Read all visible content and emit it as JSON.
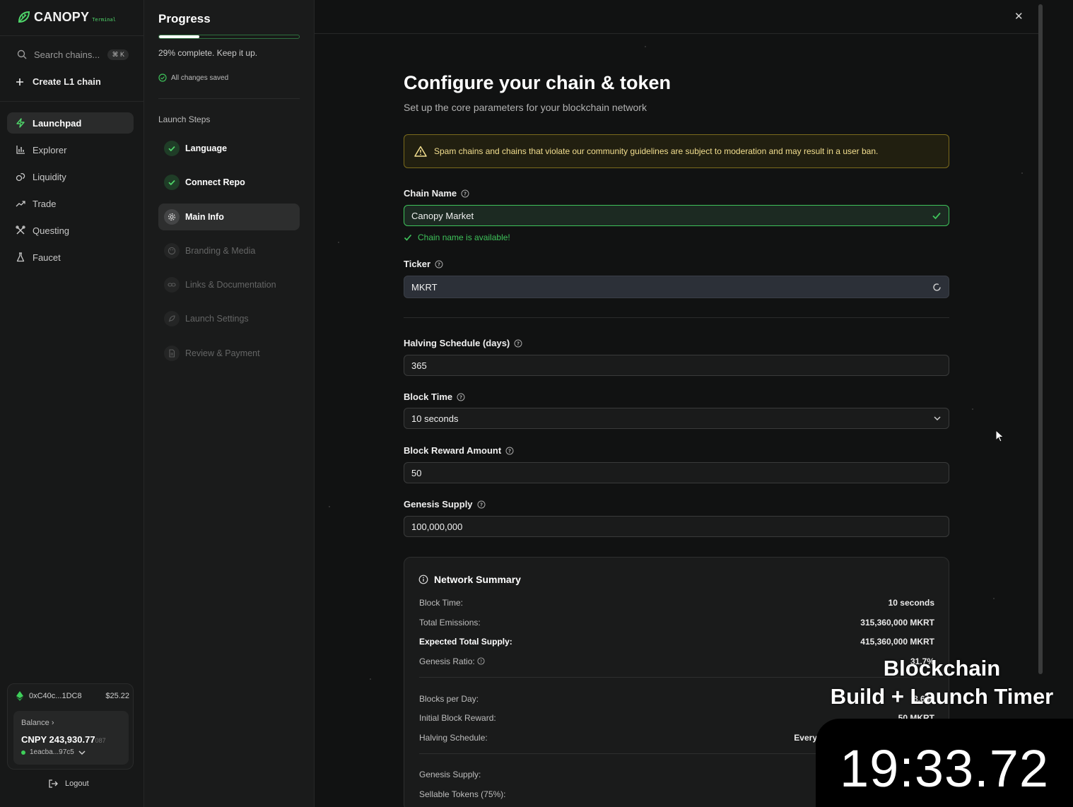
{
  "brand": {
    "name": "CANOPY",
    "sub": "Terminal"
  },
  "nav": {
    "search_placeholder": "Search chains...",
    "search_kbd": "⌘ K",
    "create_label": "Create L1 chain",
    "items": [
      {
        "label": "Launchpad",
        "icon": "bolt-icon"
      },
      {
        "label": "Explorer",
        "icon": "bar-chart-icon"
      },
      {
        "label": "Liquidity",
        "icon": "coins-icon"
      },
      {
        "label": "Trade",
        "icon": "trend-up-icon"
      },
      {
        "label": "Questing",
        "icon": "tools-icon"
      },
      {
        "label": "Faucet",
        "icon": "flask-icon"
      }
    ],
    "active_item": "Launchpad"
  },
  "wallet": {
    "address": "0xC40c...1DC8",
    "usd": "$25.22",
    "balance_label": "Balance",
    "balance_main": "CNPY 243,930.77",
    "balance_frac": "087",
    "account": "1eacba...97c5",
    "logout_label": "Logout"
  },
  "progress": {
    "title": "Progress",
    "percent": 29,
    "text": "29% complete. Keep it up.",
    "saved": "All changes saved",
    "steps_title": "Launch Steps",
    "steps": [
      {
        "label": "Language",
        "state": "done",
        "icon": "check-icon"
      },
      {
        "label": "Connect Repo",
        "state": "done",
        "icon": "check-icon"
      },
      {
        "label": "Main Info",
        "state": "active",
        "icon": "gear-icon"
      },
      {
        "label": "Branding & Media",
        "state": "todo",
        "icon": "palette-icon"
      },
      {
        "label": "Links & Documentation",
        "state": "todo",
        "icon": "link-icon"
      },
      {
        "label": "Launch Settings",
        "state": "todo",
        "icon": "rocket-icon"
      },
      {
        "label": "Review & Payment",
        "state": "todo",
        "icon": "document-icon"
      }
    ]
  },
  "form": {
    "title": "Configure your chain & token",
    "subtitle": "Set up the core parameters for your blockchain network",
    "warning": "Spam chains and chains that violate our community guidelines are subject to moderation and may result in a user ban.",
    "chain_name": {
      "label": "Chain Name",
      "value": "Canopy Market",
      "status": "Chain name is available!"
    },
    "ticker": {
      "label": "Ticker",
      "value": "MKRT"
    },
    "halving": {
      "label": "Halving Schedule (days)",
      "value": "365"
    },
    "block_time": {
      "label": "Block Time",
      "value": "10 seconds"
    },
    "block_reward": {
      "label": "Block Reward Amount",
      "value": "50"
    },
    "genesis": {
      "label": "Genesis Supply",
      "value": "100,000,000"
    }
  },
  "summary": {
    "title": "Network Summary",
    "rows": [
      {
        "k": "Block Time:",
        "v": "10 seconds"
      },
      {
        "k": "Total Emissions:",
        "v": "315,360,000 MKRT"
      },
      {
        "k": "Expected Total Supply:",
        "v": "415,360,000 MKRT"
      },
      {
        "k": "Genesis Ratio:",
        "v": "31.7%"
      },
      {
        "k": "Blocks per Day:",
        "v": "8,640"
      },
      {
        "k": "Initial Block Reward:",
        "v": "50 MKRT"
      },
      {
        "k": "Halving Schedule:",
        "v": "Every"
      },
      {
        "k": "Genesis Supply:",
        "v": ""
      },
      {
        "k": "Sellable Tokens (75%):",
        "v": ""
      }
    ]
  },
  "overlay": {
    "title_line1": "Blockchain",
    "title_line2": "Build + Launch Timer",
    "timer": "19:33.72"
  },
  "colors": {
    "accent": "#3ec25a",
    "warning": "#f3df8f"
  }
}
